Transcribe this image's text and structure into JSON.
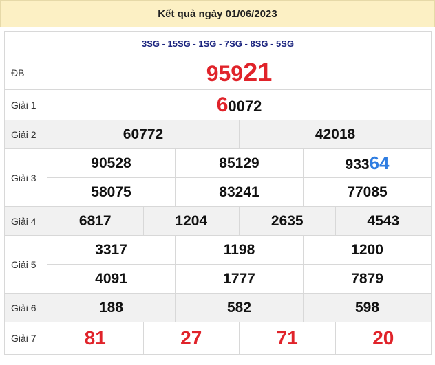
{
  "title": "Kết quả ngày 01/06/2023",
  "codes": "3SG - 15SG - 1SG - 7SG - 8SG - 5SG",
  "prizes": {
    "db": {
      "label": "ĐB",
      "prefix": "959",
      "suffix": "21"
    },
    "g1": {
      "label": "Giải 1",
      "lead": "6",
      "rest": "0072"
    },
    "g2": {
      "label": "Giải 2",
      "values": [
        "60772",
        "42018"
      ]
    },
    "g3": {
      "label": "Giải 3",
      "row1": [
        "90528",
        "85129"
      ],
      "row1_last_prefix": "933",
      "row1_last_suffix": "64",
      "row2": [
        "58075",
        "83241",
        "77085"
      ]
    },
    "g4": {
      "label": "Giải 4",
      "values": [
        "6817",
        "1204",
        "2635",
        "4543"
      ]
    },
    "g5": {
      "label": "Giải 5",
      "row1": [
        "3317",
        "1198",
        "1200"
      ],
      "row2": [
        "4091",
        "1777",
        "7879"
      ]
    },
    "g6": {
      "label": "Giải 6",
      "values": [
        "188",
        "582",
        "598"
      ]
    },
    "g7": {
      "label": "Giải 7",
      "values": [
        "81",
        "27",
        "71",
        "20"
      ]
    }
  },
  "colors": {
    "header_bg": "#fcf0c4",
    "highlight_red": "#e0232a",
    "highlight_blue": "#2f7de1",
    "codes_text": "#1a237e",
    "grey_row": "#f1f1f1"
  }
}
